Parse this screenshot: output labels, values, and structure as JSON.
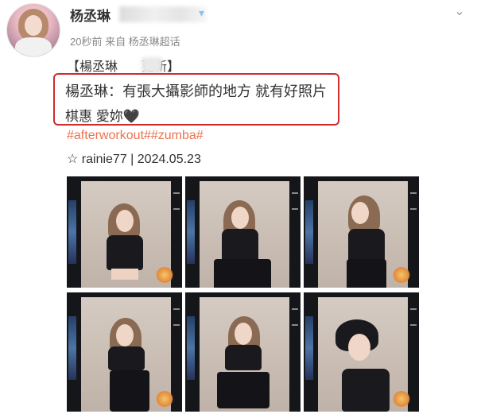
{
  "post": {
    "username": "杨丞琳",
    "meta": "20秒前 来自 杨丞琳超话",
    "title_left": "【楊丞琳",
    "title_right": "更新】",
    "quote_line1": "楊丞琳：有張大攝影師的地方 就有好照片",
    "quote_line2": "棋惠 愛妳🖤",
    "hashtags": [
      "#afterworkout#",
      "#zumba#"
    ],
    "credit": "☆ rainie77 | 2024.05.23"
  },
  "icons": {
    "vip": "vip-badge-icon",
    "menu": "chevron-down-icon"
  },
  "colors": {
    "hashtag": "#eb7350",
    "highlight_box": "#d12b2b"
  },
  "photos": [
    {
      "pose": "arms-up"
    },
    {
      "pose": "seated"
    },
    {
      "pose": "back-turn"
    },
    {
      "pose": "standing"
    },
    {
      "pose": "squat"
    },
    {
      "pose": "closeup"
    }
  ]
}
